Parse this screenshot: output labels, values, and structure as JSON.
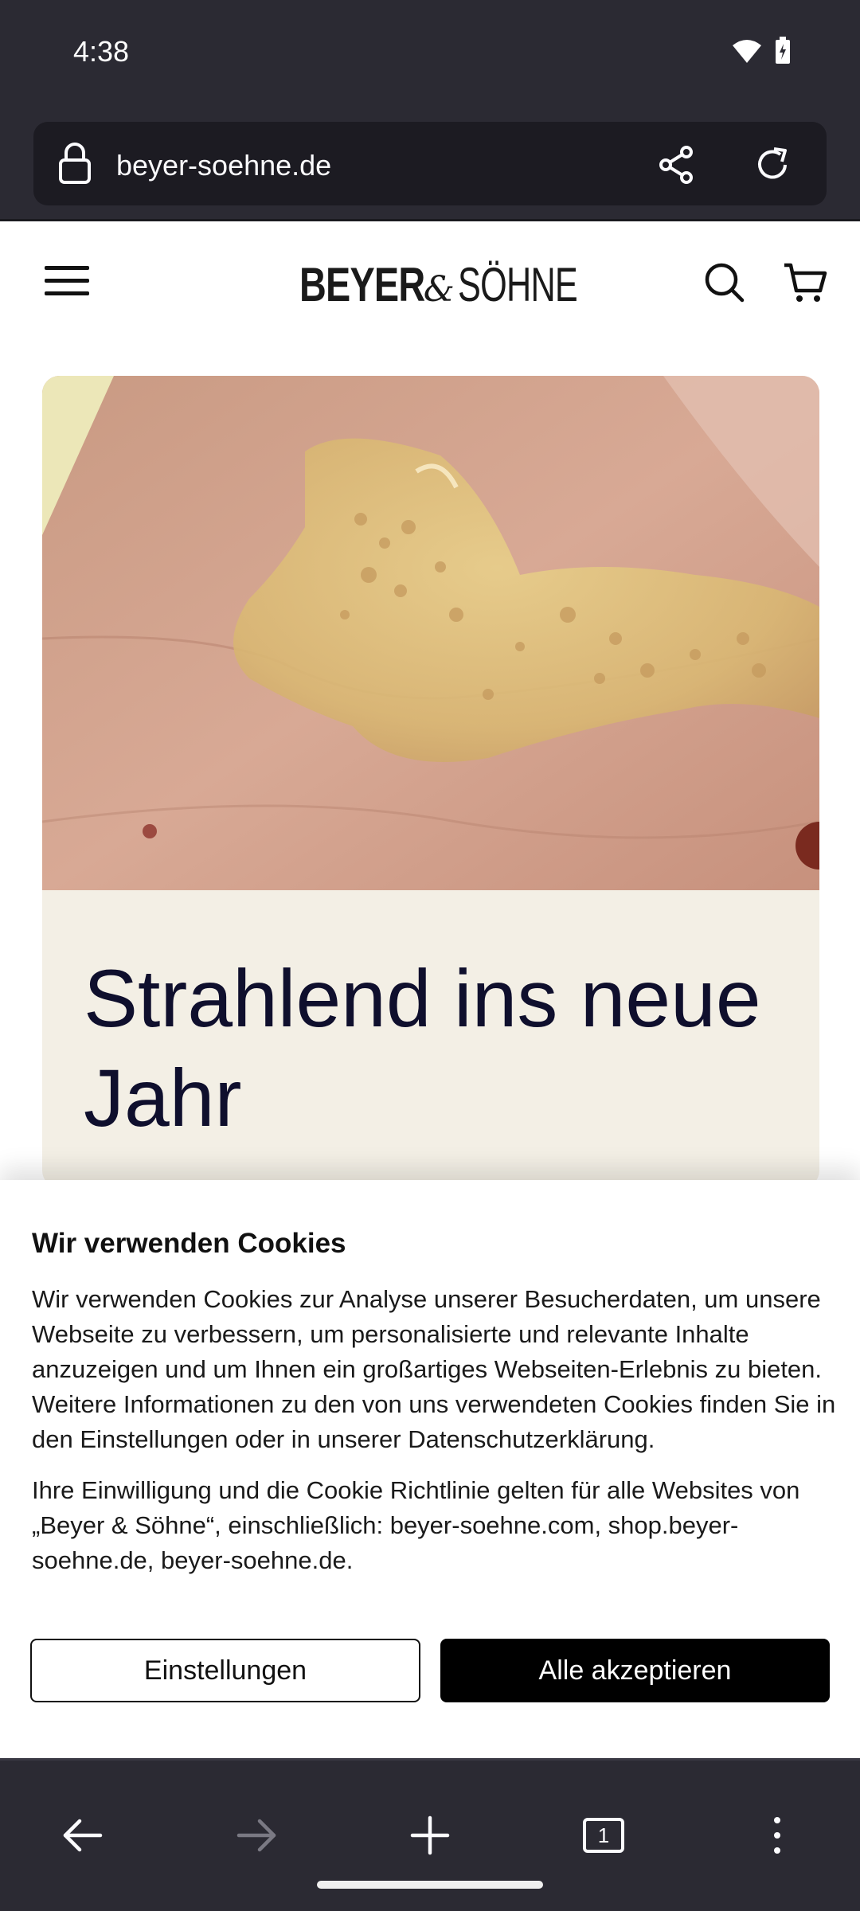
{
  "status_bar": {
    "time": "4:38"
  },
  "browser": {
    "url": "beyer-soehne.de"
  },
  "site": {
    "logo_part1": "BEYER",
    "logo_amp": "&",
    "logo_part2": "SÖHNE"
  },
  "hero": {
    "headline": "Strahlend ins neue Jahr"
  },
  "cookie_banner": {
    "title": "Wir verwenden Cookies",
    "paragraph1": "Wir verwenden Cookies zur Analyse unserer Besucherdaten, um unsere Webseite zu verbessern, um personalisierte und relevante Inhalte anzuzeigen und um Ihnen ein großartiges Webseiten-Erlebnis zu bieten. Weitere Informationen zu den von uns verwendeten Cookies finden Sie in den Einstellungen oder in unserer Datenschutzerklärung.",
    "paragraph2": "Ihre Einwilligung und die Cookie Richtlinie gelten für alle Websites von „Beyer & Söhne“, einschließlich: beyer-soehne.com, shop.beyer-soehne.de, beyer-soehne.de.",
    "settings_label": "Einstellungen",
    "accept_label": "Alle akzeptieren"
  },
  "bottom_nav": {
    "tab_count": "1"
  },
  "colors": {
    "browser_chrome": "#2b2a33",
    "hero_card_bg": "#f3efe5",
    "headline": "#0f0f2d",
    "accept_button": "#000000"
  },
  "icons": [
    "lock-icon",
    "share-icon",
    "reload-icon",
    "menu-icon",
    "search-icon",
    "cart-icon",
    "back-icon",
    "forward-icon",
    "new-tab-icon",
    "tabs-icon",
    "more-icon",
    "wifi-icon",
    "battery-icon"
  ]
}
